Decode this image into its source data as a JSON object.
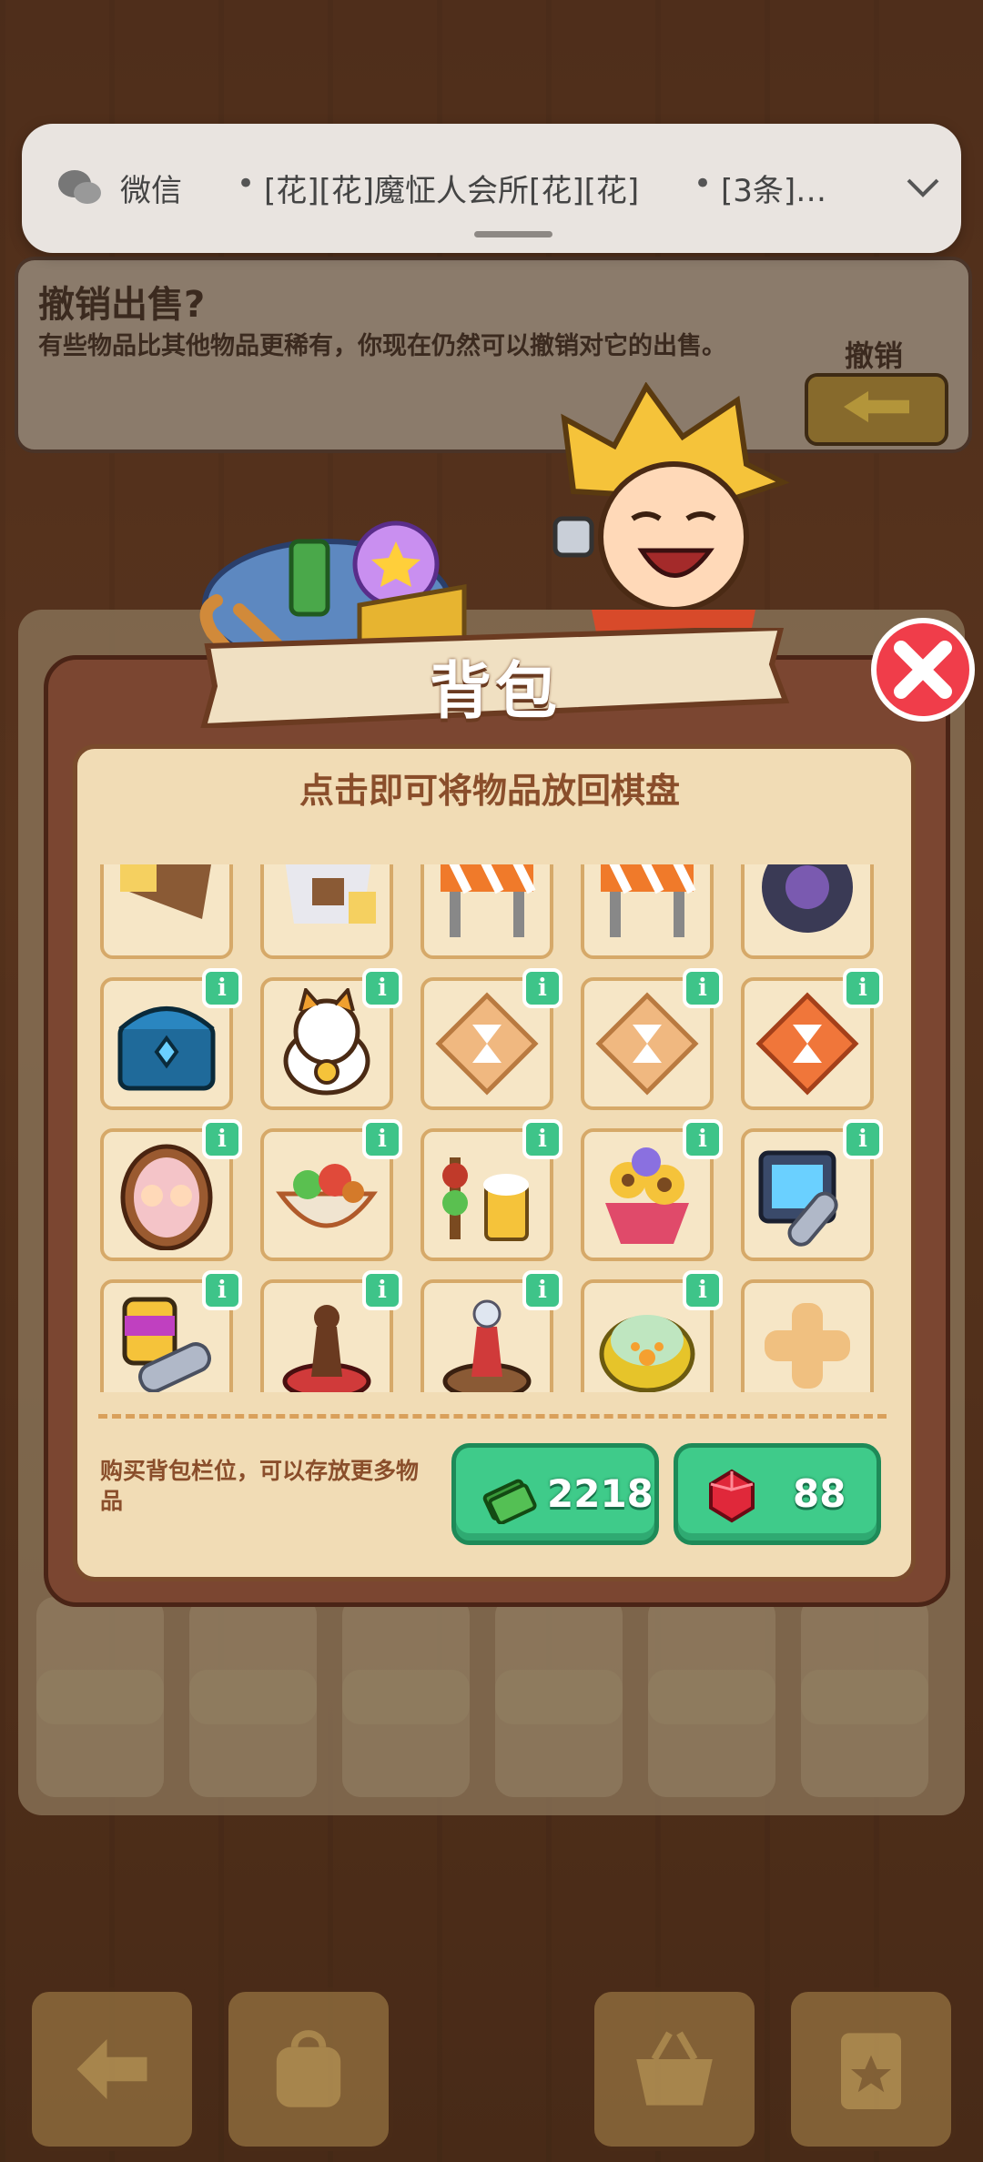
{
  "notification": {
    "app_name": "微信",
    "separator": "•",
    "group_name": "[花][花]魔怔人会所[花][花]",
    "message_count": "[3条]…"
  },
  "undo_sale": {
    "title": "撤销出售?",
    "description": "有些物品比其他物品更稀有，你现在仍然可以撤销对它的出售。",
    "button_label": "撤销"
  },
  "backpack": {
    "title": "背包",
    "hint": "点击即可将物品放回棋盘",
    "buy_slot_text": "购买背包栏位，可以存放更多物品",
    "price_cash": "2218",
    "price_gems": "88",
    "info_glyph": "i",
    "rows": [
      [
        {
          "icon": "tag-1-icon",
          "info": false
        },
        {
          "icon": "tag-2-icon",
          "info": false
        },
        {
          "icon": "roadblock-icon",
          "info": false
        },
        {
          "icon": "roadblock-icon",
          "info": false
        },
        {
          "icon": "tire-icon",
          "info": false
        }
      ],
      [
        {
          "icon": "treasure-chest-icon",
          "info": true
        },
        {
          "icon": "lucky-cat-icon",
          "info": true
        },
        {
          "icon": "hourglass-token-light-icon",
          "info": true
        },
        {
          "icon": "hourglass-token-light-icon",
          "info": true
        },
        {
          "icon": "hourglass-token-orange-icon",
          "info": true
        }
      ],
      [
        {
          "icon": "family-portrait-icon",
          "info": true
        },
        {
          "icon": "salad-bowl-icon",
          "info": true
        },
        {
          "icon": "skewers-beer-icon",
          "info": true
        },
        {
          "icon": "flower-bouquet-icon",
          "info": true
        },
        {
          "icon": "screen-scroll-icon",
          "info": true
        }
      ],
      [
        {
          "icon": "paint-roller-icon",
          "info": true
        },
        {
          "icon": "bollard-pedestal-icon",
          "info": true
        },
        {
          "icon": "bollard-orb-icon",
          "info": true
        },
        {
          "icon": "pet-bowl-icon",
          "info": true
        },
        {
          "icon": "add-slot-icon",
          "info": false
        }
      ]
    ]
  },
  "colors": {
    "accent_green": "#3ec489",
    "panel_brown": "#7b4631",
    "parchment": "#f1dcb5"
  }
}
